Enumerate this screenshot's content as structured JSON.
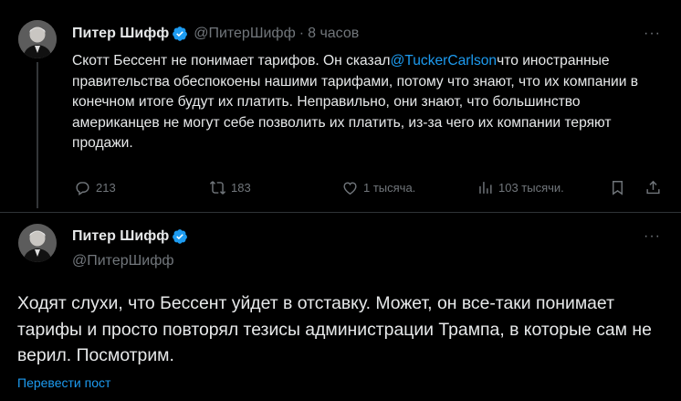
{
  "tweet1": {
    "author_name": "Питер Шифф",
    "handle": "@ПитерШифф",
    "separator": "·",
    "time": "8 часов",
    "more": "···",
    "text_before_mention": "Скотт Бессент не понимает тарифов. Он сказал",
    "mention": "@TuckerCarlson",
    "text_after_mention": "что иностранные правительства обеспокоены нашими тарифами, потому что знают, что их компании в конечном итоге будут их платить. Неправильно, они знают, что большинство американцев не могут себе позволить их платить, из-за чего их компании теряют продажи.",
    "replies": "213",
    "reposts": "183",
    "likes": "1 тысяча.",
    "views": "103 тысячи.",
    "icons": [
      "reply-icon",
      "repost-icon",
      "like-icon",
      "views-icon",
      "bookmark-icon",
      "share-icon"
    ]
  },
  "tweet2": {
    "author_name": "Питер Шифф",
    "handle": "@ПитерШифф",
    "more": "···",
    "text": "Ходят слухи, что Бессент уйдет в отставку. Может, он все-таки понимает тарифы и просто повторял тезисы администрации Трампа, в которые сам не верил. Посмотрим.",
    "translate_link": "Перевести пост"
  },
  "colors": {
    "background": "#000000",
    "text": "#e7e9ea",
    "secondary": "#71767b",
    "accent": "#1d9bf0",
    "divider": "#2f3336"
  }
}
